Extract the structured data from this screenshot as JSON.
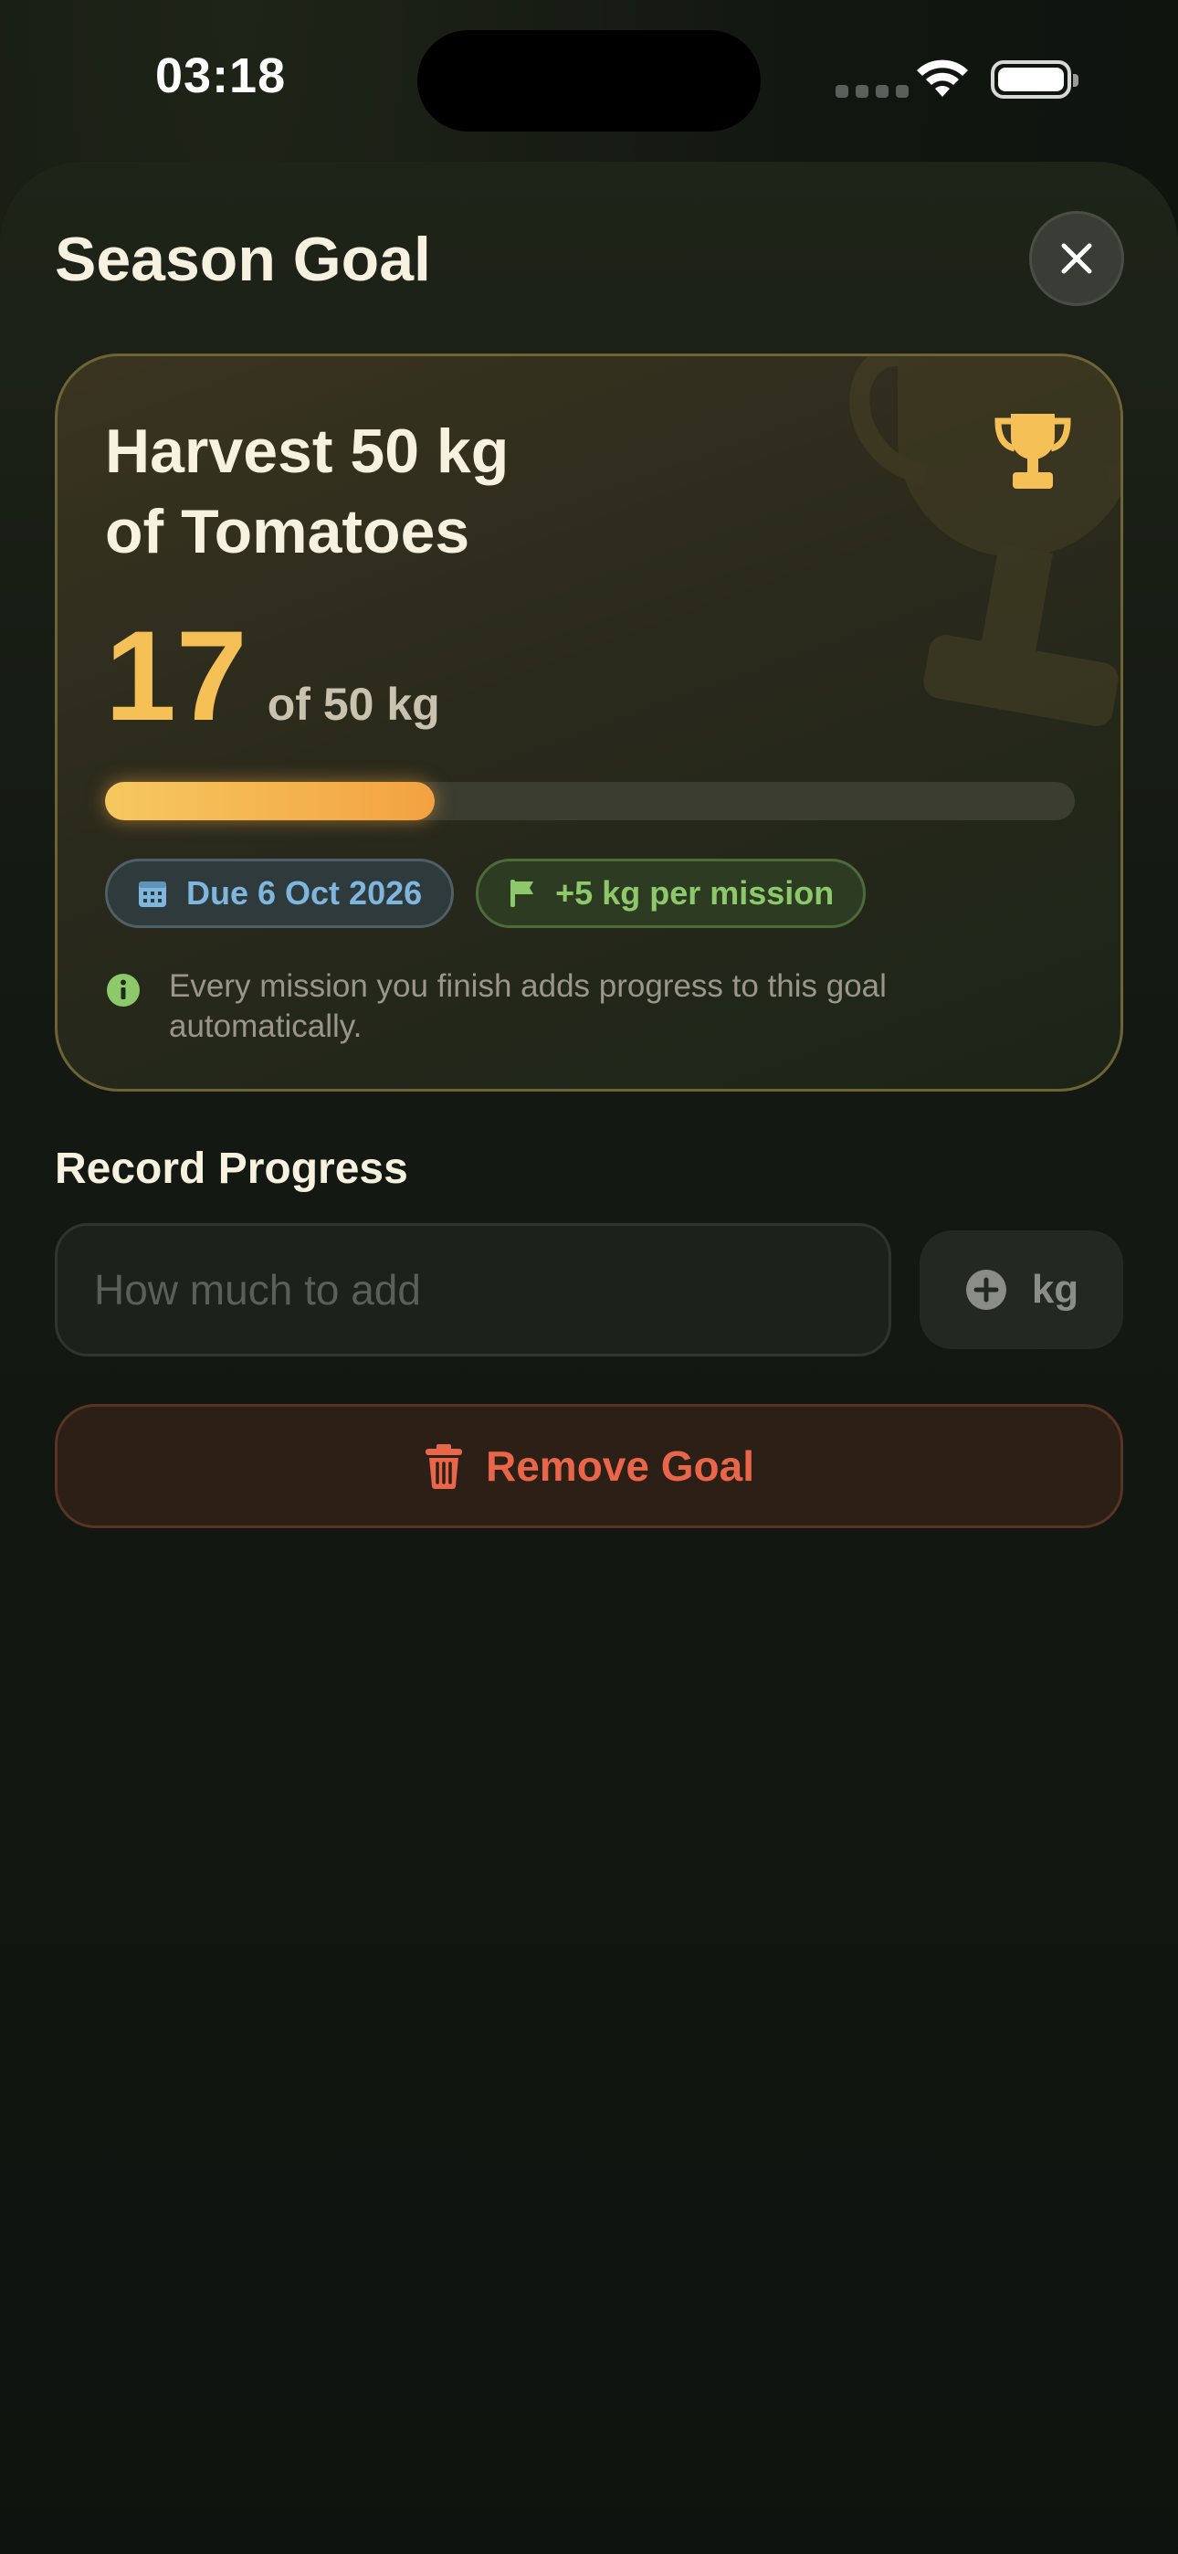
{
  "status_bar": {
    "time": "03:18"
  },
  "sheet": {
    "title": "Season Goal"
  },
  "goal": {
    "title_line1": "Harvest 50 kg",
    "title_line2": "of Tomatoes",
    "current": "17",
    "target_label": "of 50 kg",
    "progress_fraction": 0.34,
    "due_chip": "Due 6 Oct 2026",
    "mission_chip": "+5 kg per mission",
    "info": "Every mission you finish adds progress to this goal automatically."
  },
  "record": {
    "title": "Record Progress",
    "input_value": "",
    "input_placeholder": "How much to add",
    "unit_button": "kg"
  },
  "remove_button": "Remove Goal",
  "colors": {
    "accent_gold": "#f5c055",
    "progress_end": "#f3a241",
    "chip_blue": "#7fb6de",
    "chip_green": "#8dc96a",
    "danger": "#e9664a"
  },
  "icons": {
    "close": "close-icon",
    "trophy": "trophy-icon",
    "calendar": "calendar-icon",
    "flag": "flag-icon",
    "info": "info-icon",
    "plus": "plus-circle-icon",
    "trash": "trash-icon"
  }
}
